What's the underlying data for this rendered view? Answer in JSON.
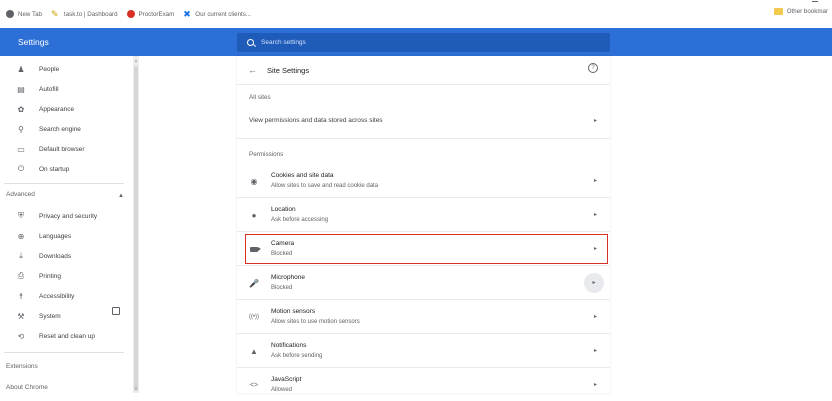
{
  "bookmarks": {
    "items": [
      {
        "label": "New Tab",
        "icon": "new-tab-icon"
      },
      {
        "label": "task.to | Dashboard",
        "icon": "task-icon"
      },
      {
        "label": "ProctorExam",
        "icon": "proctorexam-icon"
      },
      {
        "label": "Our current clients...",
        "icon": "clients-icon"
      }
    ],
    "other": "Other bookmar"
  },
  "header": {
    "title": "Settings",
    "search_placeholder": "Search settings"
  },
  "sidebar": {
    "items": [
      {
        "label": "People",
        "icon": "person-icon",
        "glyph": "👤"
      },
      {
        "label": "Autofill",
        "icon": "clipboard-icon",
        "glyph": "▤"
      },
      {
        "label": "Appearance",
        "icon": "palette-icon",
        "glyph": "✿"
      },
      {
        "label": "Search engine",
        "icon": "search-icon",
        "glyph": "⚲"
      },
      {
        "label": "Default browser",
        "icon": "browser-icon",
        "glyph": "▭"
      },
      {
        "label": "On startup",
        "icon": "power-icon",
        "glyph": "⏻"
      }
    ],
    "advanced_label": "Advanced",
    "advanced_items": [
      {
        "label": "Privacy and security",
        "icon": "shield-icon",
        "glyph": "⛨"
      },
      {
        "label": "Languages",
        "icon": "globe-icon",
        "glyph": "⊕"
      },
      {
        "label": "Downloads",
        "icon": "download-icon",
        "glyph": "⤓"
      },
      {
        "label": "Printing",
        "icon": "printer-icon",
        "glyph": "⎙"
      },
      {
        "label": "Accessibility",
        "icon": "accessibility-icon",
        "glyph": "☨"
      },
      {
        "label": "System",
        "icon": "wrench-icon",
        "glyph": "🔧"
      },
      {
        "label": "Reset and clean up",
        "icon": "restore-icon",
        "glyph": "⟲"
      }
    ],
    "extensions_label": "Extensions",
    "about_label": "About Chrome"
  },
  "site_settings": {
    "title": "Site Settings",
    "all_sites_label": "All sites",
    "view_permissions_label": "View permissions and data stored across sites",
    "permissions_label": "Permissions",
    "permissions": [
      {
        "title": "Cookies and site data",
        "sub": "Allow sites to save and read cookie data",
        "icon": "cookie-icon"
      },
      {
        "title": "Location",
        "sub": "Ask before accessing",
        "icon": "location-pin-icon"
      },
      {
        "title": "Camera",
        "sub": "Blocked",
        "icon": "camera-icon"
      },
      {
        "title": "Microphone",
        "sub": "Blocked",
        "icon": "microphone-icon"
      },
      {
        "title": "Motion sensors",
        "sub": "Allow sites to use motion sensors",
        "icon": "motion-sensor-icon"
      },
      {
        "title": "Notifications",
        "sub": "Ask before sending",
        "icon": "bell-icon"
      },
      {
        "title": "JavaScript",
        "sub": "Allowed",
        "icon": "code-icon"
      }
    ]
  },
  "colors": {
    "header": "#2c6fd6",
    "search_box": "#1f5bb8",
    "highlight": "#d93025"
  }
}
